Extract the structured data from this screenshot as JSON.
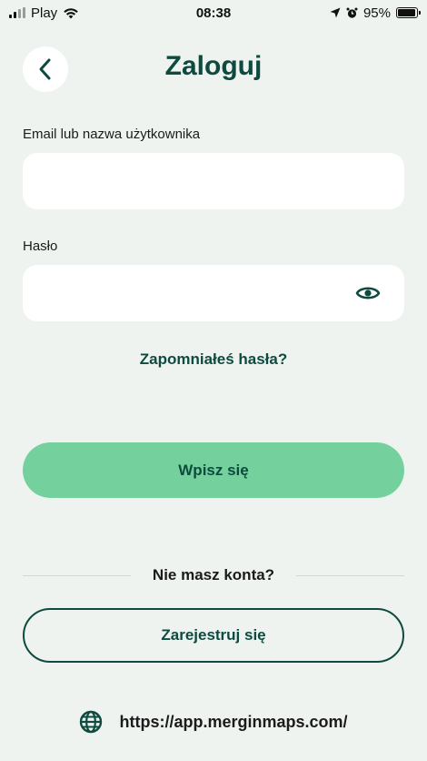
{
  "status_bar": {
    "carrier": "Play",
    "time": "08:38",
    "battery_percent": "95%",
    "battery_level": 0.95,
    "icons": [
      "signal-icon",
      "wifi-icon",
      "location-arrow-icon",
      "alarm-icon",
      "battery-icon"
    ]
  },
  "header": {
    "title": "Zaloguj",
    "back_icon": "chevron-left-icon"
  },
  "form": {
    "username_label": "Email lub nazwa użytkownika",
    "username_value": "",
    "username_placeholder": "",
    "password_label": "Hasło",
    "password_value": "",
    "password_placeholder": "",
    "password_toggle_icon": "eye-icon",
    "forgot_password": "Zapomniałeś hasła?",
    "submit_label": "Wpisz się"
  },
  "signup": {
    "prompt": "Nie masz konta?",
    "register_label": "Zarejestruj się"
  },
  "server": {
    "icon": "globe-icon",
    "url": "https://app.merginmaps.com/"
  },
  "colors": {
    "background": "#eef3f0",
    "brand_dark": "#0f4a40",
    "primary_button": "#74d19d",
    "input_background": "#ffffff"
  }
}
